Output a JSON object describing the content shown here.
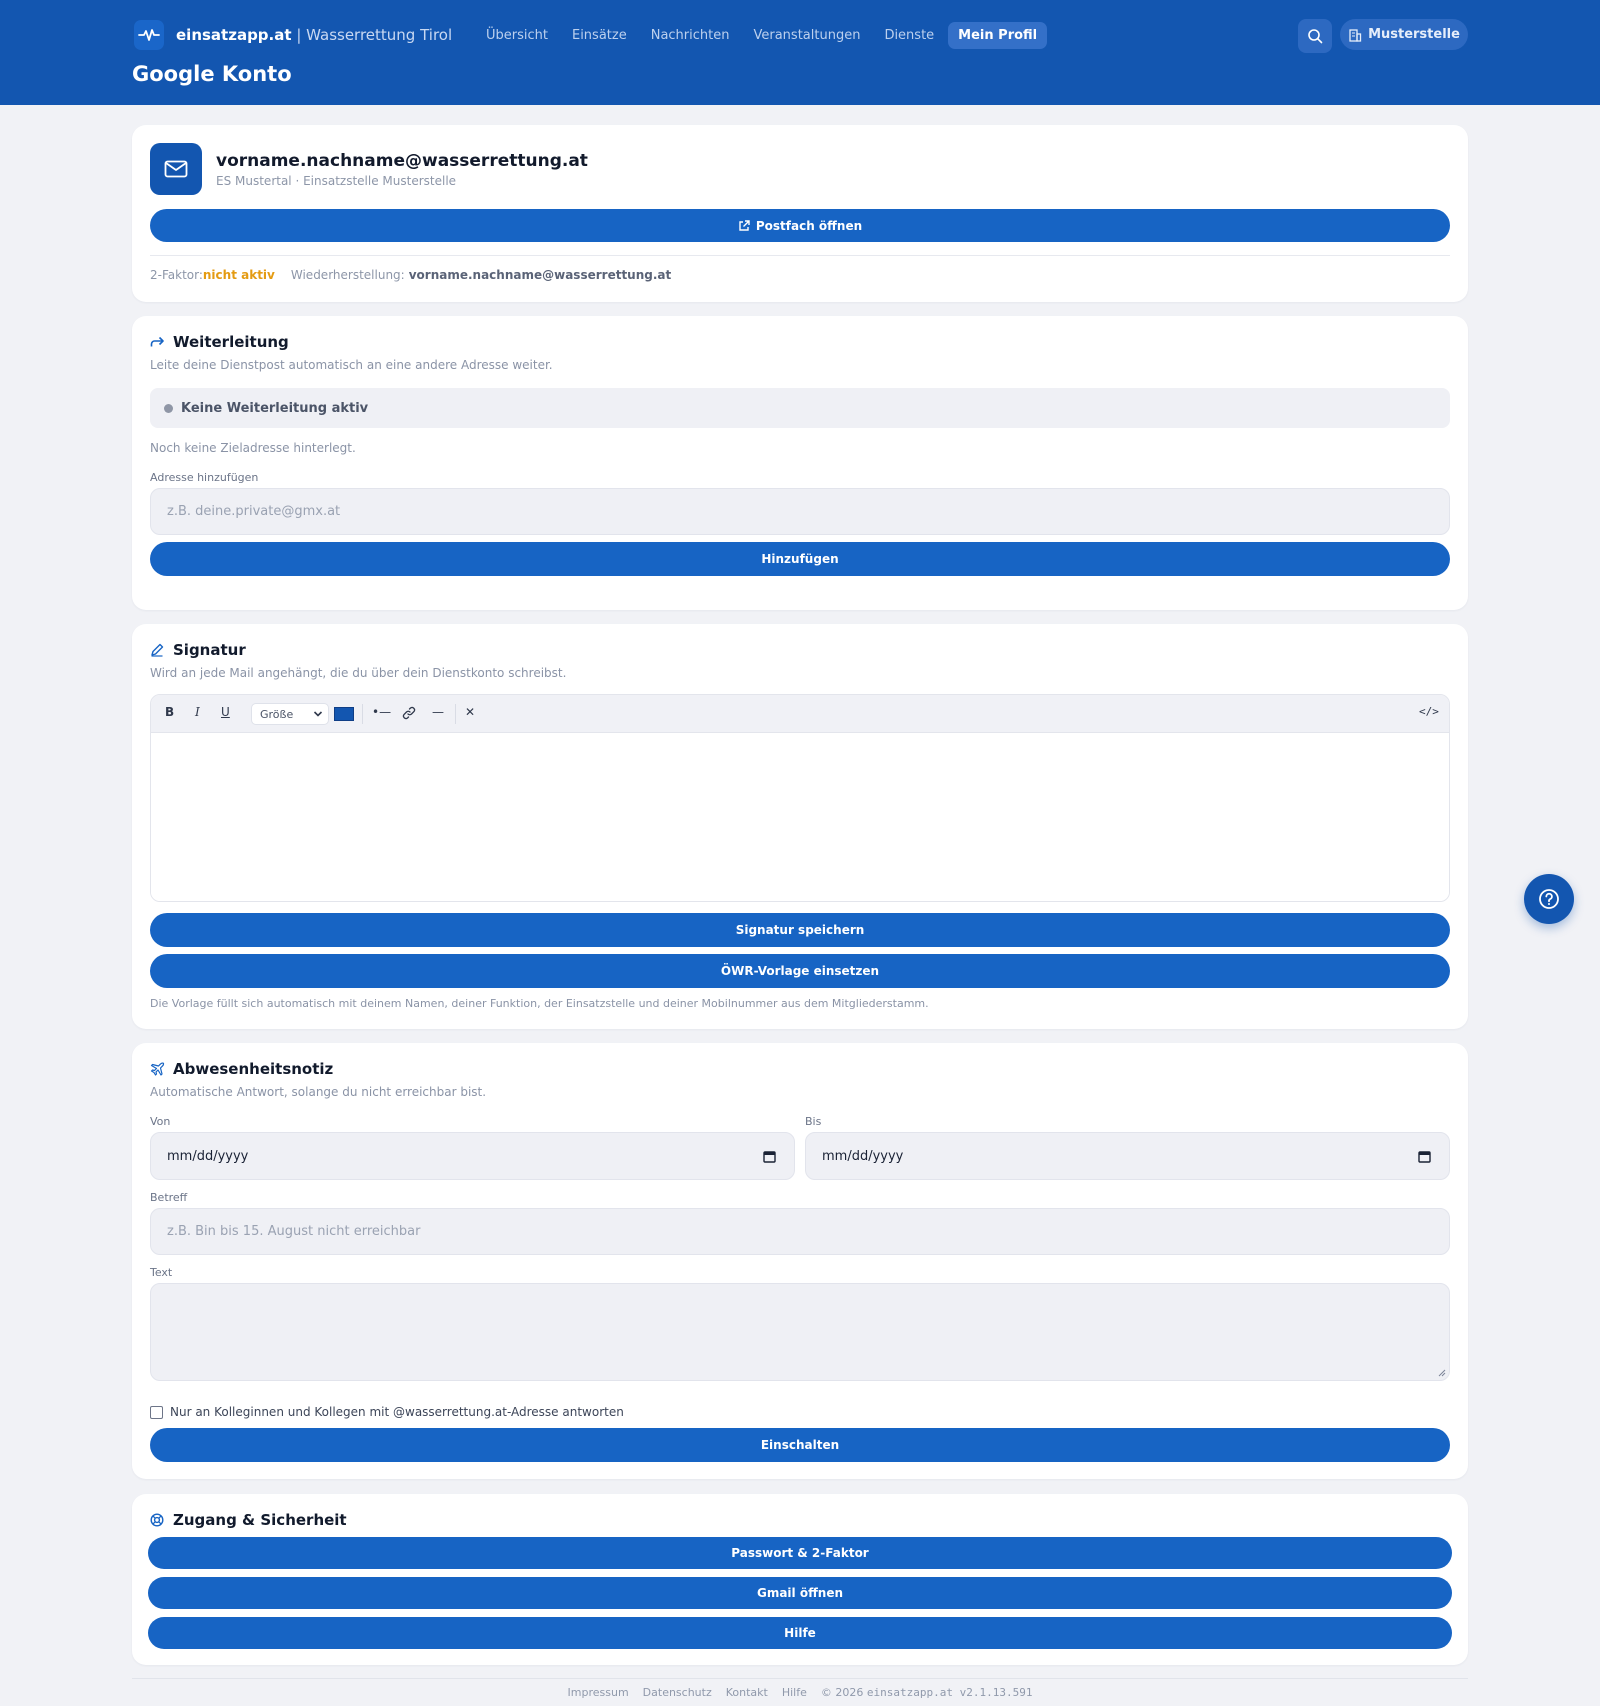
{
  "header": {
    "brand_name": "einsatzapp.at",
    "brand_sub": " | Wasserrettung Tirol",
    "nav": [
      "Übersicht",
      "Einsätze",
      "Nachrichten",
      "Veranstaltungen",
      "Dienste",
      "Mein Profil"
    ],
    "active_nav": "Mein Profil",
    "org_label": "Musterstelle",
    "page_title": "Google Konto"
  },
  "account": {
    "email": "vorname.nachname@wasserrettung.at",
    "subtitle": "ES Mustertal · Einsatzstelle Musterstelle",
    "open_mailbox_label": "Postfach öffnen",
    "twofa_label": "2-Faktor:",
    "twofa_status": "nicht aktiv",
    "recovery_label": "Wiederherstellung:",
    "recovery_email": "vorname.nachname@wasserrettung.at"
  },
  "forwarding": {
    "title": "Weiterleitung",
    "subtitle": "Leite deine Dienstpost automatisch an eine andere Adresse weiter.",
    "status": "Keine Weiterleitung aktiv",
    "empty_note": "Noch keine Zieladresse hinterlegt.",
    "add_label": "Adresse hinzufügen",
    "add_placeholder": "z.B. deine.private@gmx.at",
    "add_button": "Hinzufügen"
  },
  "signature": {
    "title": "Signatur",
    "subtitle": "Wird an jede Mail angehängt, die du über dein Dienstkonto schreibst.",
    "toolbar": {
      "bold": "B",
      "italic": "I",
      "underline": "U",
      "size_select": "Größe",
      "list": "•—",
      "rule": "—",
      "clear": "✕",
      "source": "</>"
    },
    "text_color": "#1356b0",
    "save_button": "Signatur speichern",
    "template_button": "ÖWR-Vorlage einsetzen",
    "template_note": "Die Vorlage füllt sich automatisch mit deinem Namen, deiner Funktion, der Einsatzstelle und deiner Mobilnummer aus dem Mitgliederstamm."
  },
  "absence": {
    "title": "Abwesenheitsnotiz",
    "subtitle": "Automatische Antwort, solange du nicht erreichbar bist.",
    "from_label": "Von",
    "from_value": "mm/dd/yyyy",
    "to_label": "Bis",
    "to_value": "mm/dd/yyyy",
    "subject_label": "Betreff",
    "subject_placeholder": "z.B. Bin bis 15. August nicht erreichbar",
    "text_label": "Text",
    "colleagues_only": "Nur an Kolleginnen und Kollegen mit @wasserrettung.at-Adresse antworten",
    "enable_button": "Einschalten"
  },
  "security": {
    "title": "Zugang & Sicherheit",
    "buttons": [
      "Passwort & 2-Faktor",
      "Gmail öffnen",
      "Hilfe"
    ]
  },
  "footer": {
    "links": [
      "Impressum",
      "Datenschutz",
      "Kontakt",
      "Hilfe"
    ],
    "copyright": "© 2026",
    "version": "einsatzapp.at v2.1.13.591"
  },
  "colors": {
    "header": "#1356b0",
    "primary_button": "#1764c4",
    "warning": "#e49b12",
    "page_bg": "#f1f2f6"
  }
}
